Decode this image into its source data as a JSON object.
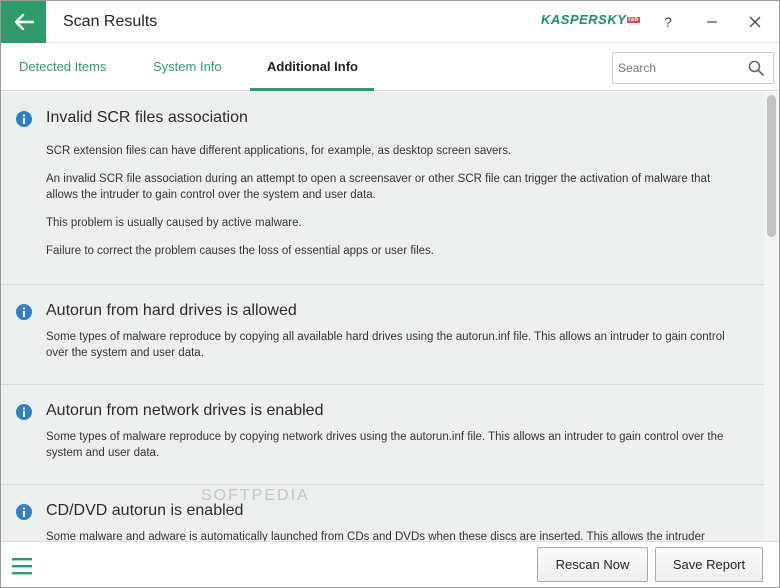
{
  "window": {
    "title": "Scan Results",
    "brand": "KASPERSKY",
    "brand_badge": "lab",
    "help_label": "?",
    "minimize_label": "—",
    "close_label": "✕"
  },
  "tabs": [
    {
      "label": "Detected Items",
      "active": false
    },
    {
      "label": "System Info",
      "active": false
    },
    {
      "label": "Additional Info",
      "active": true
    }
  ],
  "search": {
    "placeholder": "Search",
    "value": ""
  },
  "sections": [
    {
      "title": "Invalid SCR files association",
      "paragraphs": [
        "SCR extension files can have different applications, for example, as desktop screen savers.",
        "An invalid SCR file association during an attempt to open a screensaver or other SCR file can trigger the activation of malware that allows the intruder to gain control over the system and user data.",
        "This problem is usually caused by active malware.",
        "Failure to correct the problem causes the loss of essential apps or user files."
      ]
    },
    {
      "title": "Autorun from hard drives is allowed",
      "paragraphs": [
        "Some types of malware reproduce by copying all available hard drives using the autorun.inf file. This allows an intruder to gain control over the system and user data."
      ]
    },
    {
      "title": "Autorun from network drives is enabled",
      "paragraphs": [
        "Some types of malware reproduce by copying network drives using the autorun.inf file. This allows an intruder to gain control over the system and user data."
      ]
    },
    {
      "title": "CD/DVD autorun is enabled",
      "paragraphs": [
        "Some malware and adware is automatically launched from CDs and DVDs when these discs are inserted. This allows the intruder"
      ]
    }
  ],
  "watermark": "SOFTPEDIA",
  "footer": {
    "rescan_label": "Rescan Now",
    "save_label": "Save Report"
  },
  "colors": {
    "accent": "#2f9b6b",
    "info_icon": "#2f7fc4",
    "content_bg": "#eef0f0"
  },
  "icons": {
    "back": "arrow-left-icon",
    "search": "search-icon",
    "info": "info-icon",
    "menu": "hamburger-menu-icon"
  }
}
